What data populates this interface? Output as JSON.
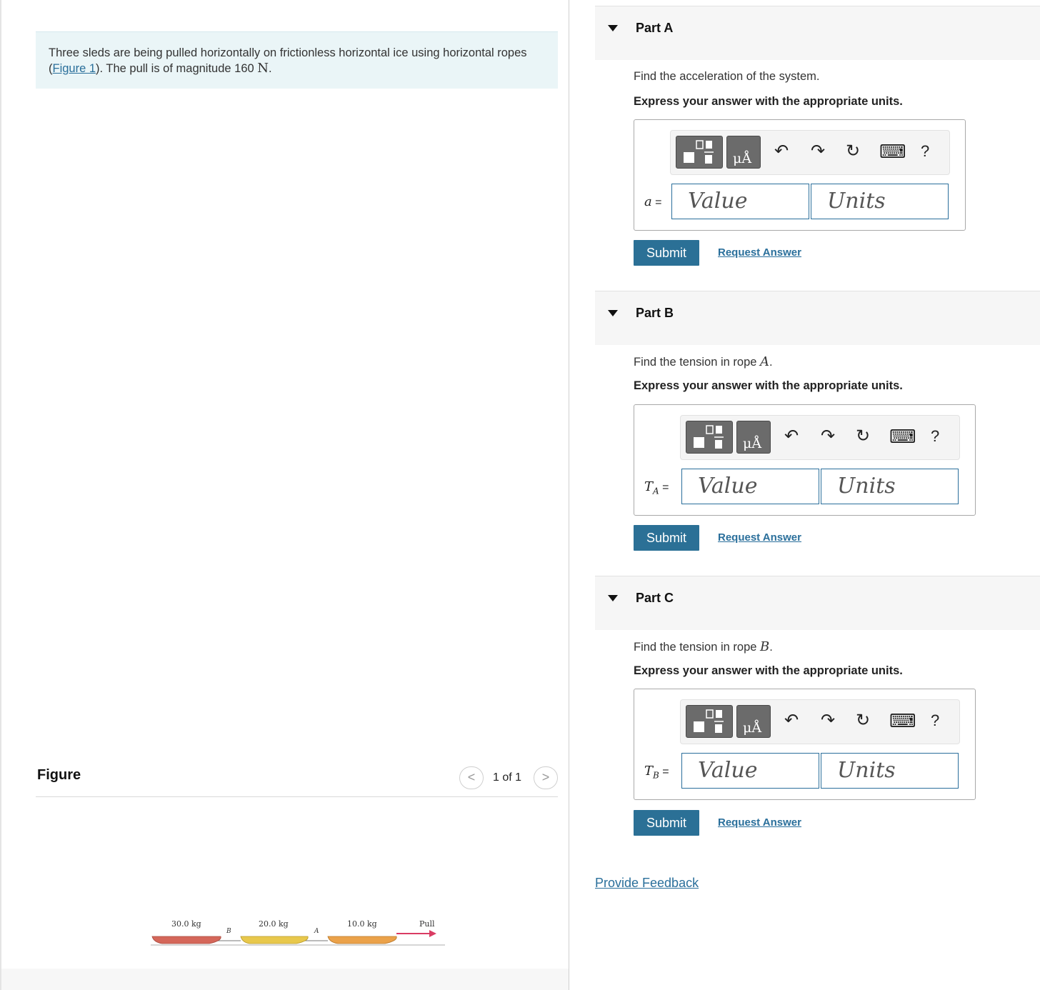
{
  "problem": {
    "text_before": "Three sleds are being pulled horizontally on frictionless horizontal ice using horizontal ropes (",
    "figure_link": "Figure 1",
    "text_after": "). The pull is of magnitude 160 ",
    "unit": "N",
    "end": "."
  },
  "figure": {
    "title": "Figure",
    "pager_prev": "<",
    "pager_text": "1 of 1",
    "pager_next": ">",
    "labels": {
      "sled1": "30.0 kg",
      "rope_b": "B",
      "sled2": "20.0 kg",
      "rope_a": "A",
      "sled3": "10.0 kg",
      "pull": "Pull"
    },
    "colors": {
      "sled1": "#d5675a",
      "sled2": "#e8c84c",
      "sled3": "#eba24a",
      "pull_arrow": "#d93c63"
    }
  },
  "toolbar": {
    "templates_icon": "templates-icon",
    "units_glyph": "μÅ",
    "undo": "↶",
    "redo": "↷",
    "reset": "↻",
    "keyboard": "⌨",
    "help": "?"
  },
  "parts": [
    {
      "title": "Part A",
      "q_text": "Find the acceleration of the system.",
      "q_var": "",
      "q_end": "",
      "instruction": "Express your answer with the appropriate units.",
      "var": "a",
      "var_sub": "",
      "eq": " =",
      "value_placeholder": "Value",
      "units_placeholder": "Units",
      "submit": "Submit",
      "request": "Request Answer"
    },
    {
      "title": "Part B",
      "q_text": "Find the tension in rope ",
      "q_var": "A",
      "q_end": ".",
      "instruction": "Express your answer with the appropriate units.",
      "var": "T",
      "var_sub": "A",
      "eq": " =",
      "value_placeholder": "Value",
      "units_placeholder": "Units",
      "submit": "Submit",
      "request": "Request Answer"
    },
    {
      "title": "Part C",
      "q_text": "Find the tension in rope ",
      "q_var": "B",
      "q_end": ".",
      "instruction": "Express your answer with the appropriate units.",
      "var": "T",
      "var_sub": "B",
      "eq": " =",
      "value_placeholder": "Value",
      "units_placeholder": "Units",
      "submit": "Submit",
      "request": "Request Answer"
    }
  ],
  "feedback_link": "Provide Feedback",
  "accent_color": "#2b7096"
}
